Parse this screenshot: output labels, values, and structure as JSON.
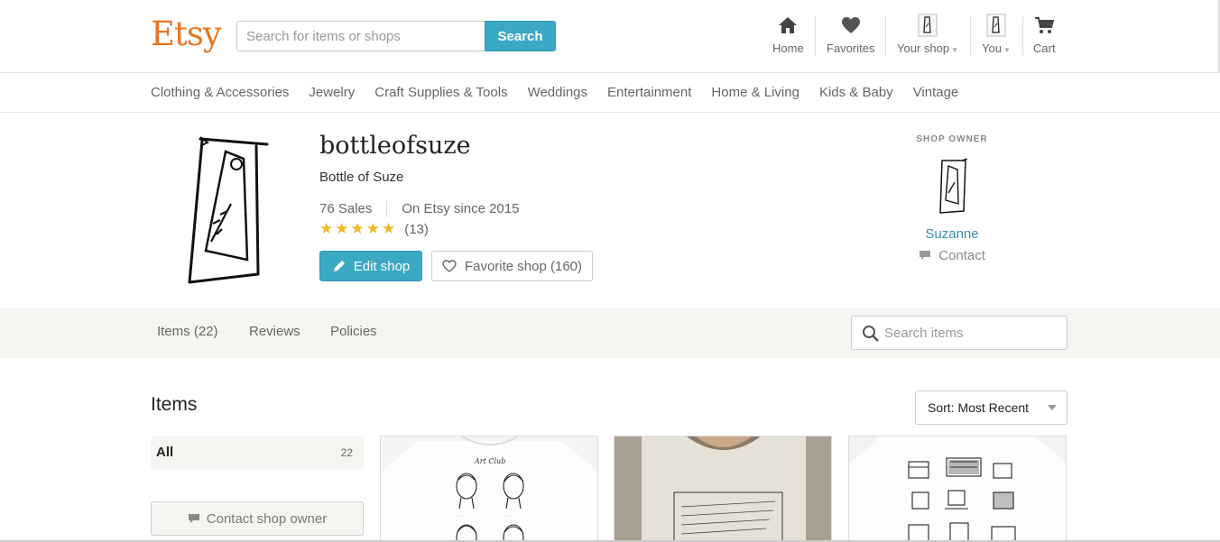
{
  "header": {
    "logo": "Etsy",
    "search_placeholder": "Search for items or shops",
    "search_button": "Search",
    "nav": {
      "home": "Home",
      "favorites": "Favorites",
      "your_shop": "Your shop",
      "you": "You",
      "cart": "Cart"
    }
  },
  "categories": [
    "Clothing & Accessories",
    "Jewelry",
    "Craft Supplies & Tools",
    "Weddings",
    "Entertainment",
    "Home & Living",
    "Kids & Baby",
    "Vintage"
  ],
  "shop": {
    "name": "bottleofsuze",
    "title": "Bottle of Suze",
    "sales": "76 Sales",
    "since": "On Etsy since 2015",
    "rating_stars": 5,
    "rating_count": "(13)",
    "edit_button": "Edit shop",
    "favorite_button": "Favorite shop (160)"
  },
  "owner": {
    "heading": "SHOP OWNER",
    "name": "Suzanne",
    "contact": "Contact"
  },
  "tabs": {
    "items": "Items (22)",
    "reviews": "Reviews",
    "policies": "Policies",
    "search_placeholder": "Search items"
  },
  "items_section": {
    "heading": "Items",
    "sort": "Sort: Most Recent",
    "all_label": "All",
    "all_count": "22",
    "contact_owner": "Contact shop owner"
  },
  "listings": [
    {
      "caption": "Art Club"
    },
    {
      "caption": ""
    },
    {
      "caption": ""
    }
  ],
  "colors": {
    "brand": "#e87722",
    "accent": "#3ba8c4",
    "star": "#f1b924"
  }
}
